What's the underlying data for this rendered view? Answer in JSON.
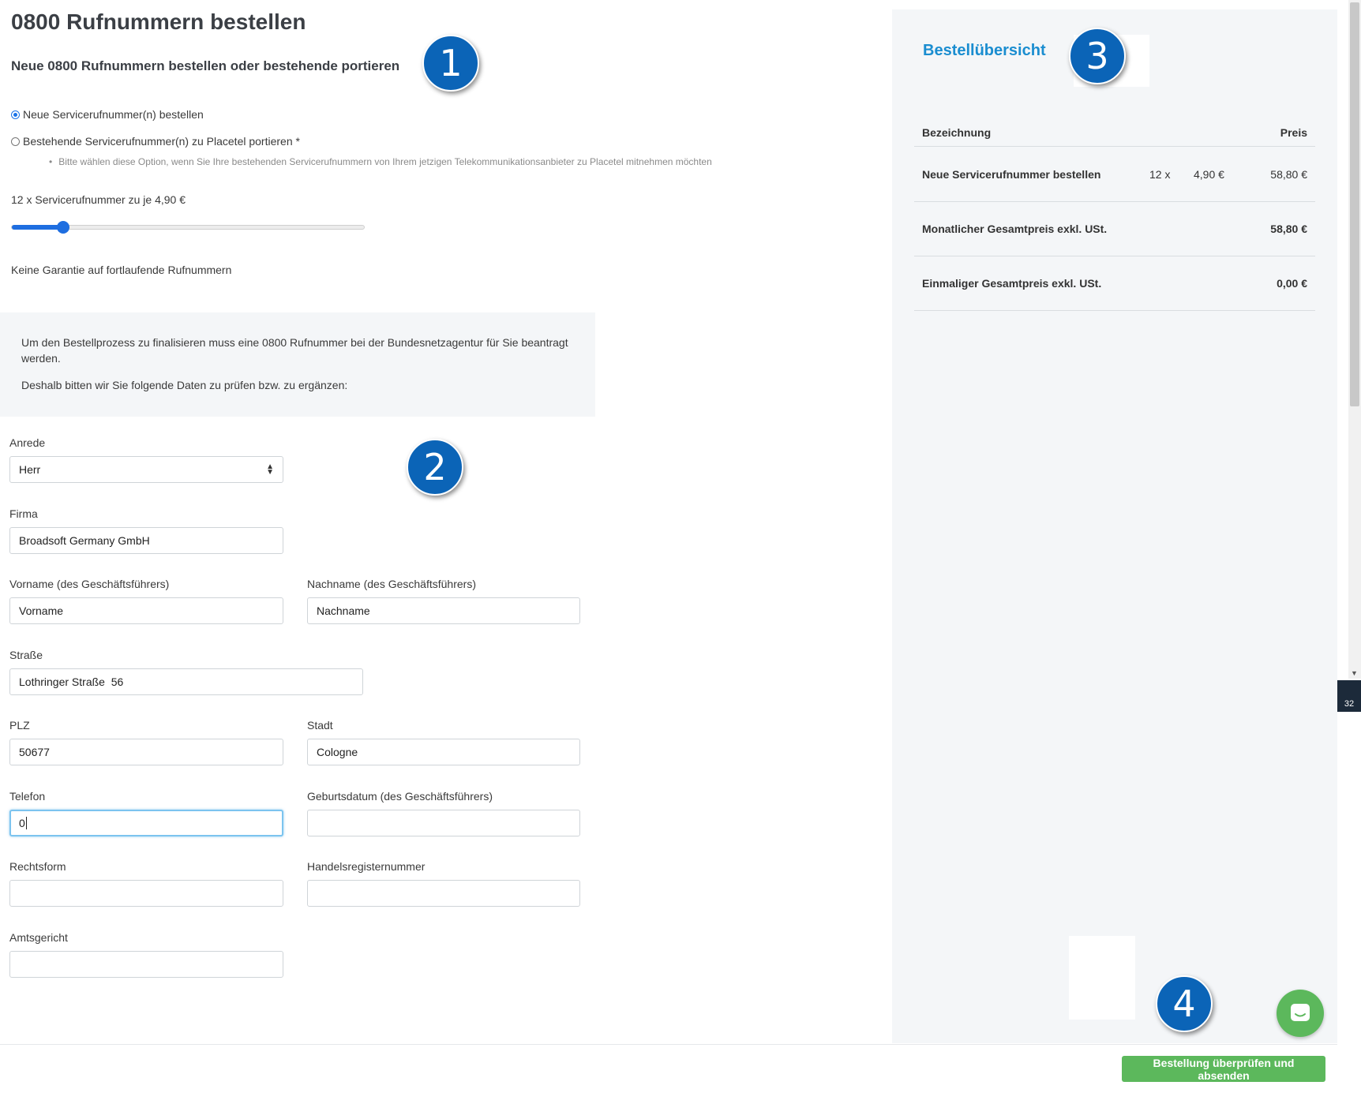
{
  "page": {
    "title": "0800 Rufnummern bestellen",
    "subtitle": "Neue 0800 Rufnummern bestellen oder bestehende portieren"
  },
  "order_type": {
    "option_new": "Neue Servicerufnummer(n) bestellen",
    "option_port": "Bestehende Servicerufnummer(n) zu Placetel portieren *",
    "port_hint": "Bitte wählen diese Option, wenn Sie Ihre bestehenden Servicerufnummern von Ihrem jetzigen Telekommunikationsanbieter zu Placetel mitnehmen möchten",
    "selected": "new"
  },
  "quantity": {
    "label": "12 x Servicerufnummer zu je 4,90 €",
    "slider_fraction": 0.145
  },
  "no_guarantee": "Keine Garantie auf fortlaufende Rufnummern",
  "info": {
    "line1": "Um den Bestellprozess zu finalisieren muss eine 0800 Rufnummer bei der Bundesnetzagentur für Sie beantragt werden.",
    "line2": "Deshalb bitten wir Sie folgende Daten zu prüfen bzw. zu ergänzen:"
  },
  "form": {
    "anrede": {
      "label": "Anrede",
      "value": "Herr"
    },
    "firma": {
      "label": "Firma",
      "value": "Broadsoft Germany GmbH"
    },
    "vorname": {
      "label": "Vorname (des Geschäftsführers)",
      "value": "Vorname"
    },
    "nachname": {
      "label": "Nachname (des Geschäftsführers)",
      "value": "Nachname"
    },
    "strasse": {
      "label": "Straße",
      "value": "Lothringer Straße  56"
    },
    "plz": {
      "label": "PLZ",
      "value": "50677"
    },
    "stadt": {
      "label": "Stadt",
      "value": "Cologne"
    },
    "telefon": {
      "label": "Telefon",
      "value": "0"
    },
    "geburtsdatum": {
      "label": "Geburtsdatum (des Geschäftsführers)",
      "value": ""
    },
    "rechtsform": {
      "label": "Rechtsform",
      "value": ""
    },
    "handelsregister": {
      "label": "Handelsregisternummer",
      "value": ""
    },
    "amtsgericht": {
      "label": "Amtsgericht",
      "value": ""
    }
  },
  "summary": {
    "title": "Bestellübersicht",
    "col_name": "Bezeichnung",
    "col_price": "Preis",
    "item": {
      "name": "Neue Servicerufnummer bestellen",
      "qty": "12 x",
      "unit": "4,90 €",
      "price": "58,80 €"
    },
    "monthly": {
      "label": "Monatlicher Gesamtpreis exkl. USt.",
      "value": "58,80 €"
    },
    "onetime": {
      "label": "Einmaliger Gesamtpreis exkl. USt.",
      "value": "0,00 €"
    }
  },
  "submit_label": "Bestellung überprüfen und absenden",
  "badges": [
    "1",
    "2",
    "3",
    "4"
  ],
  "tray_text": "32",
  "colors": {
    "accent": "#1e6ee0",
    "title_blue": "#1a8dd0",
    "submit_green": "#5cb85c",
    "badge_blue": "#0b64b7"
  },
  "icons": {
    "chat": "chat-bubble-icon",
    "select": "sort-arrows-icon"
  }
}
